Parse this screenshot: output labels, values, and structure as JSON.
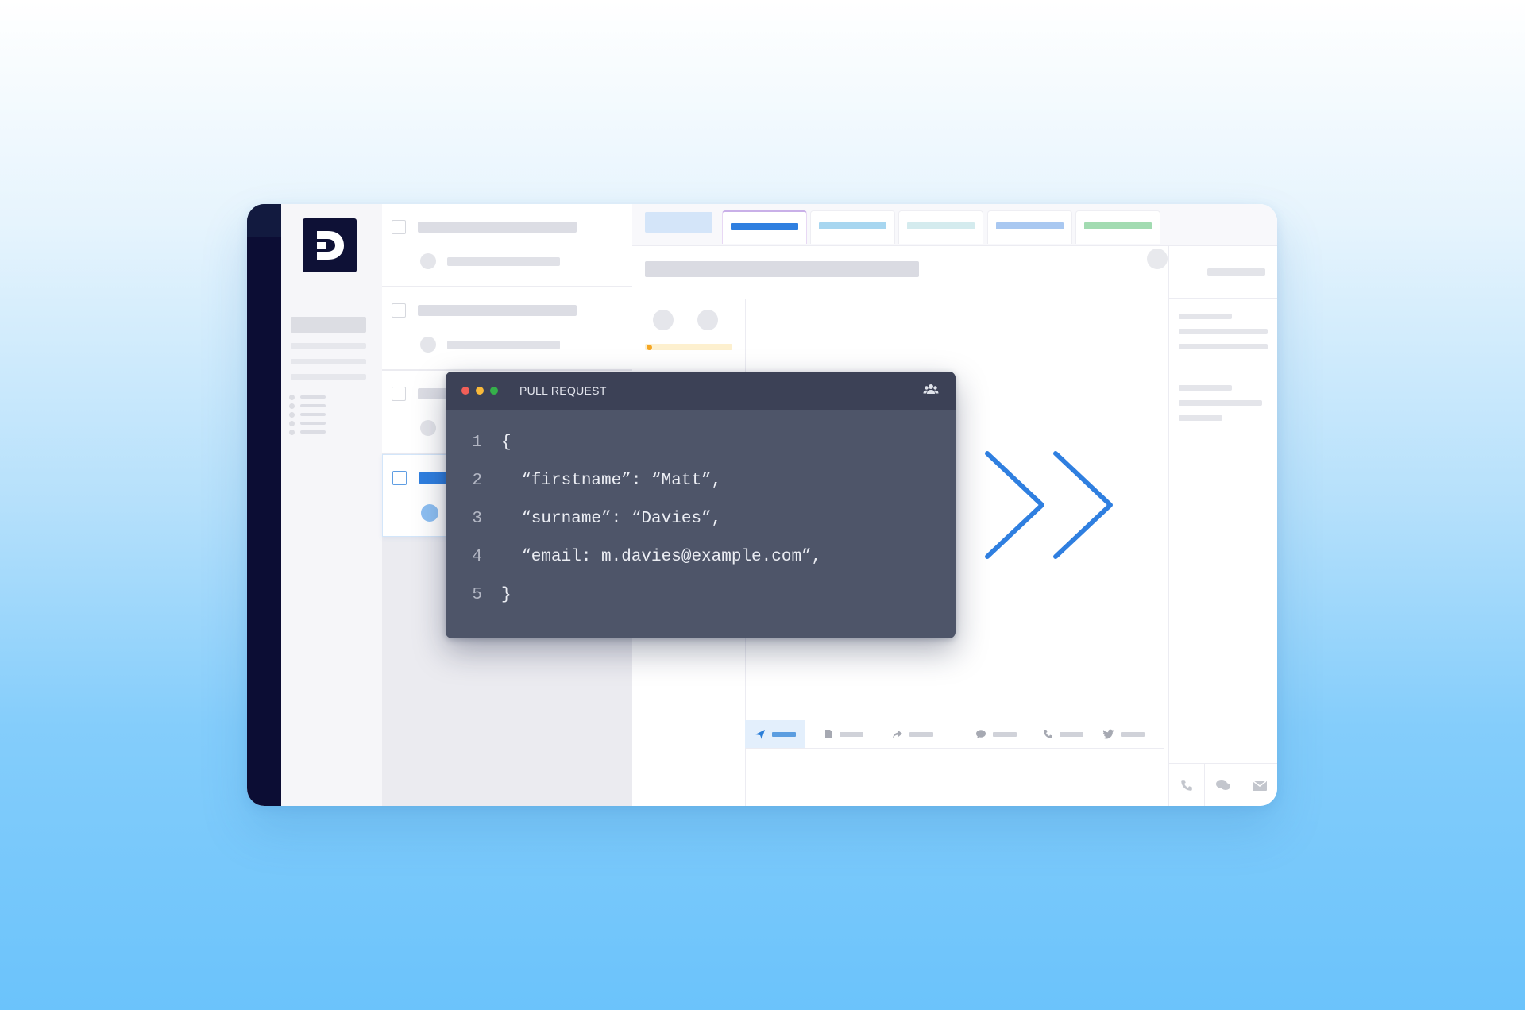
{
  "code_window": {
    "title": "PULL REQUEST",
    "icon": "team-icon",
    "lines": [
      {
        "num": "1",
        "text": "{"
      },
      {
        "num": "2",
        "text": "  “firstname”: “Matt”,"
      },
      {
        "num": "3",
        "text": "  “surname”: “Davies”,"
      },
      {
        "num": "4",
        "text": "  “email: m.davies@example.com”,"
      },
      {
        "num": "5",
        "text": "}"
      }
    ]
  },
  "app": {
    "logo": "D",
    "reply_toolbar_icons": [
      "send-icon",
      "note-icon",
      "forward-icon",
      "chat-icon",
      "phone-icon",
      "twitter-icon"
    ],
    "right_bottom_icons": [
      "phone-icon",
      "chat-icon",
      "mail-icon"
    ]
  },
  "colors": {
    "accent": "#2f7fe0",
    "nav_dark": "#0c0d34",
    "code_bg": "#4e5569",
    "code_titlebar": "#3c4156",
    "dot_red": "#f25f58",
    "dot_yellow": "#f8b93a",
    "dot_green": "#35b04a"
  }
}
